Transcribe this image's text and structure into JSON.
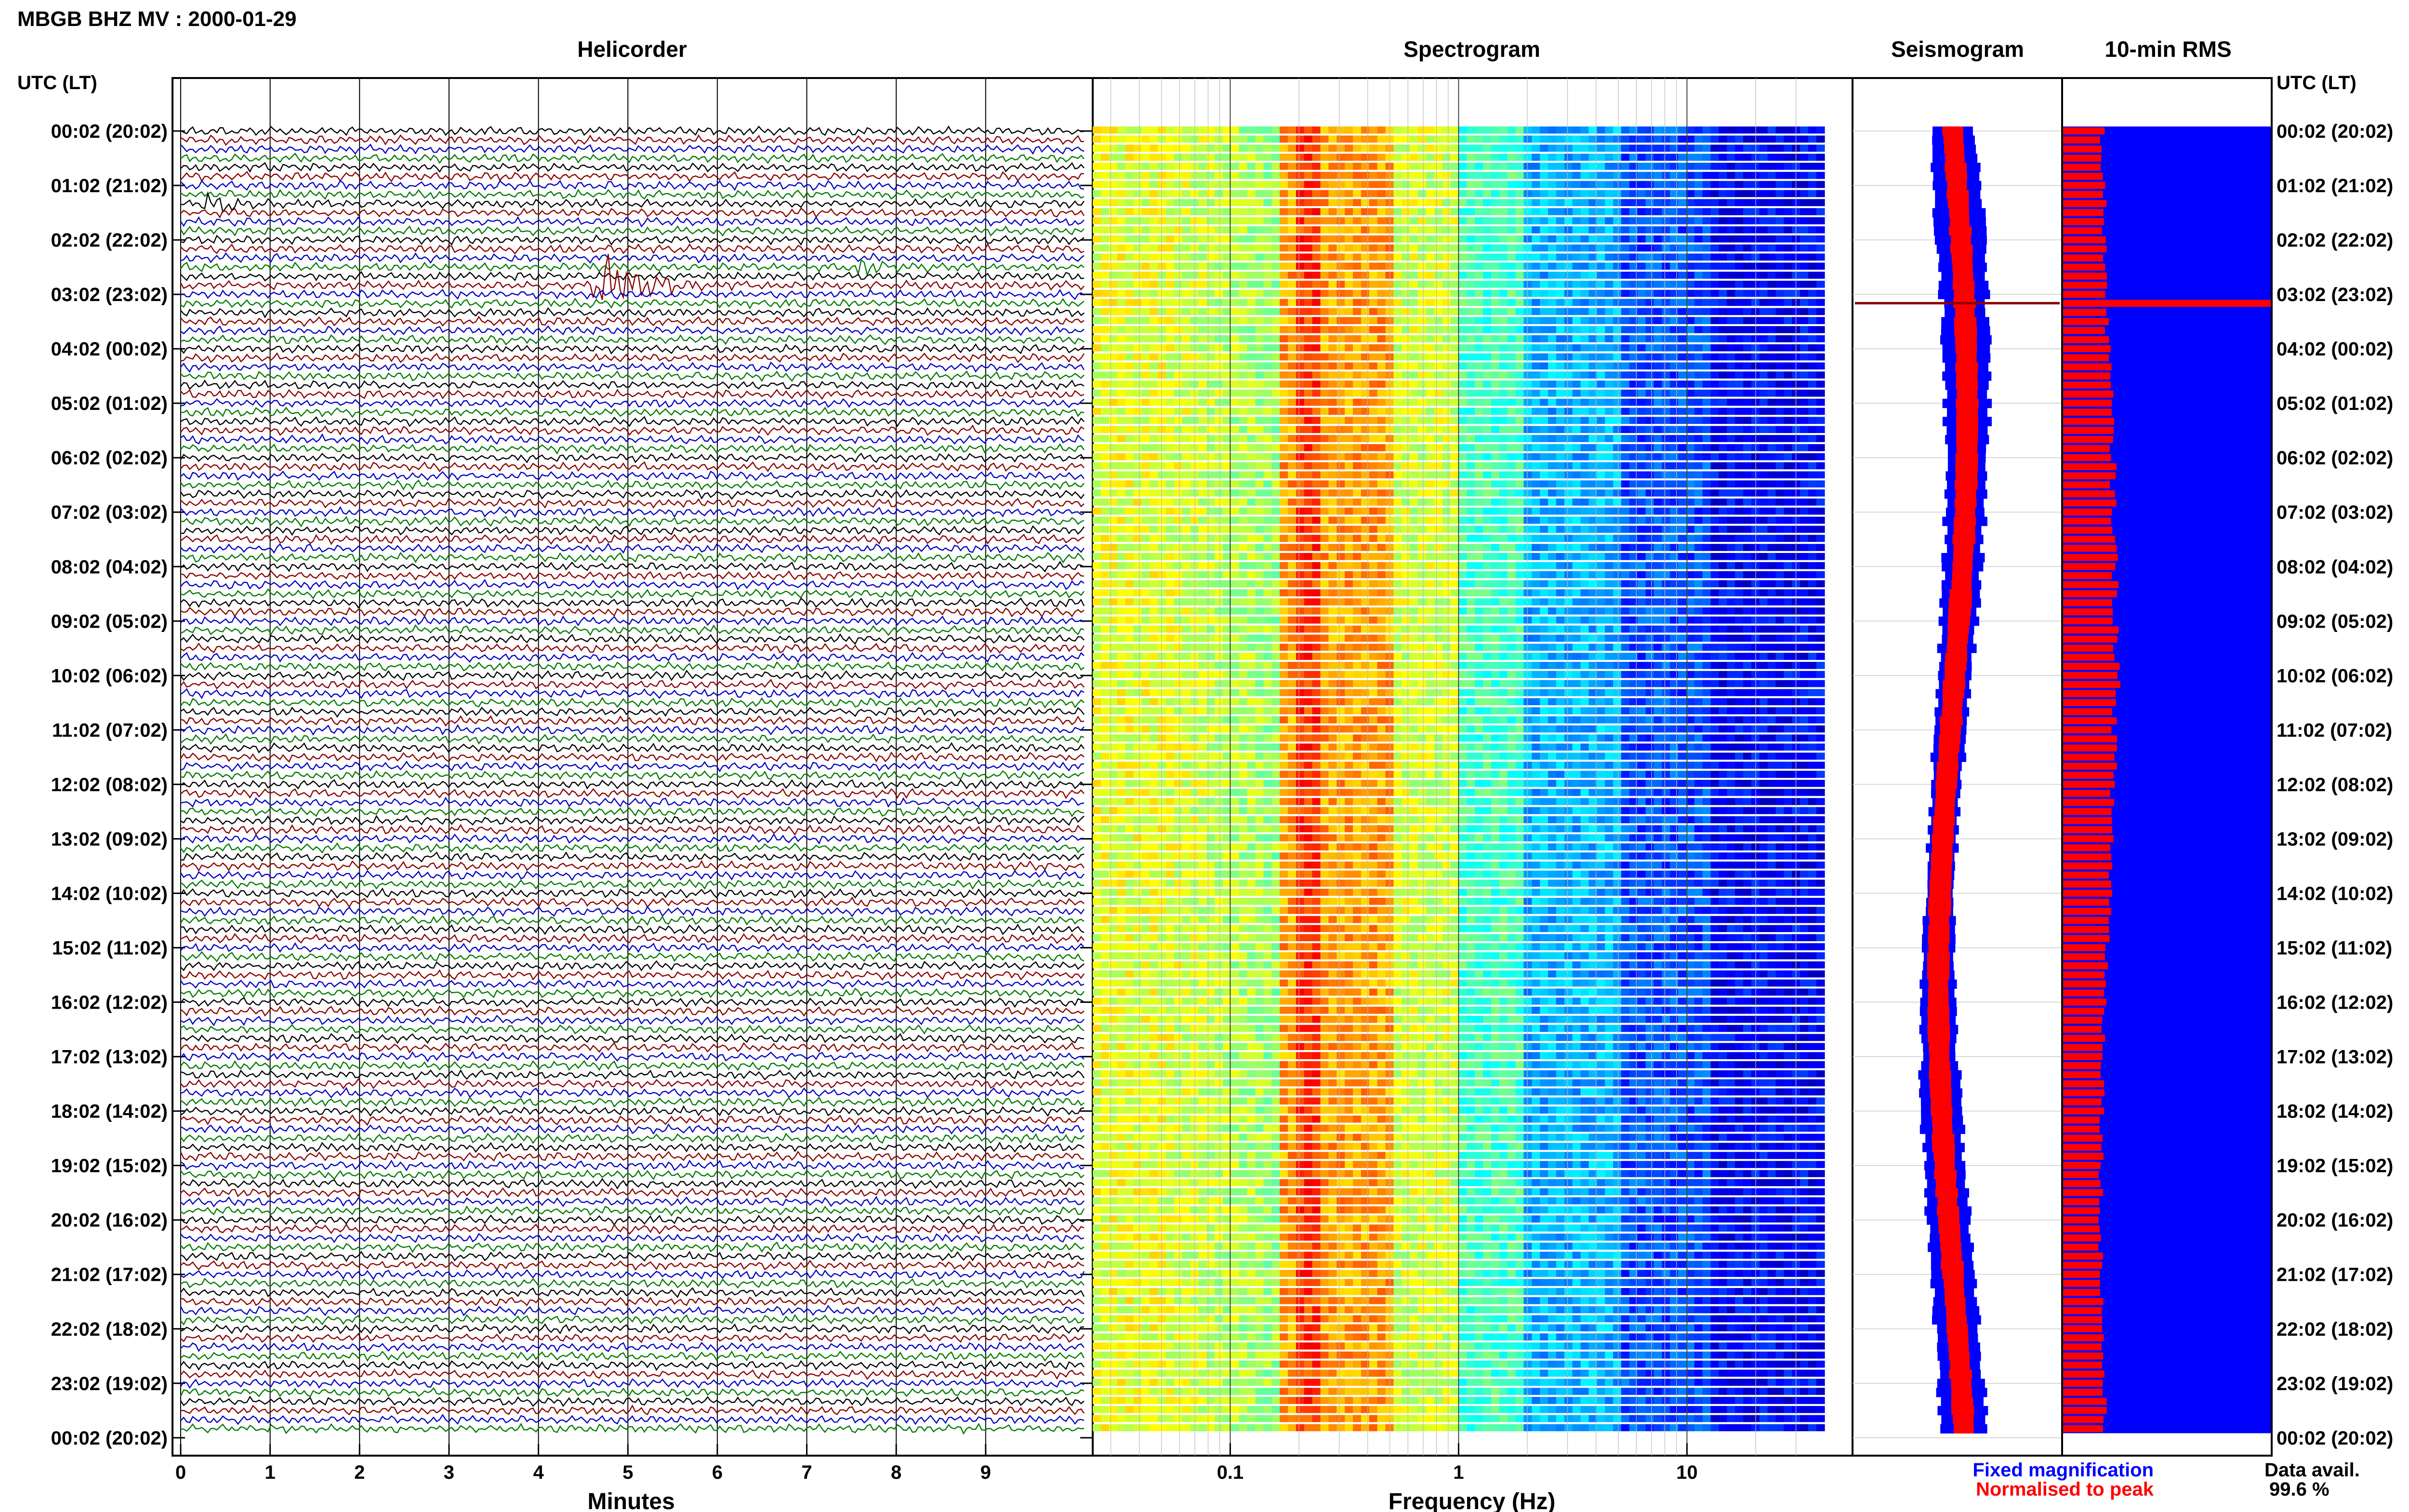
{
  "page_title": "MBGB BHZ MV : 2000-01-29",
  "utc_header_left": "UTC (LT)",
  "utc_header_right": "UTC (LT)",
  "panels": {
    "helicorder": {
      "title": "Helicorder",
      "xlabel": "Minutes",
      "xticks": [
        "0",
        "1",
        "2",
        "3",
        "4",
        "5",
        "6",
        "7",
        "8",
        "9"
      ],
      "trace_colors": [
        "#000000",
        "#8b0000",
        "#0000c8",
        "#007a00"
      ]
    },
    "spectrogram": {
      "title": "Spectrogram",
      "xlabel": "Frequency (Hz)",
      "xticks": [
        "0.1",
        "1",
        "10"
      ],
      "colormap": [
        "#00008f",
        "#0000ff",
        "#0080ff",
        "#00ffff",
        "#80ff80",
        "#ffff00",
        "#ff8000",
        "#ff0000",
        "#800000"
      ]
    },
    "seismogram": {
      "title": "Seismogram",
      "legend_fixed": "Fixed magnification",
      "legend_fixed_color": "#0000ff",
      "legend_norm": "Normalised to peak",
      "legend_norm_color": "#ff0000"
    },
    "rms": {
      "title": "10-min RMS",
      "bar_color": "#ff0000",
      "background_color": "#0000ff"
    }
  },
  "data_avail_label": "Data avail.",
  "data_avail_value": "99.6 %",
  "time_labels": [
    "00:02 (20:02)",
    "01:02 (21:02)",
    "02:02 (22:02)",
    "03:02 (23:02)",
    "04:02 (00:02)",
    "05:02 (01:02)",
    "06:02 (02:02)",
    "07:02 (03:02)",
    "08:02 (04:02)",
    "09:02 (05:02)",
    "10:02 (06:02)",
    "11:02 (07:02)",
    "12:02 (08:02)",
    "13:02 (09:02)",
    "14:02 (10:02)",
    "15:02 (11:02)",
    "16:02 (12:02)",
    "17:02 (13:02)",
    "18:02 (14:02)",
    "19:02 (15:02)",
    "20:02 (16:02)",
    "21:02 (17:02)",
    "22:02 (18:02)",
    "23:02 (19:02)",
    "00:02 (20:02)"
  ],
  "chart_data": {
    "type": "heatmap",
    "title": "MBGB BHZ MV : 2000-01-29",
    "rows_per_hour": 6,
    "row_count": 144,
    "rms_profile_rows": [
      0,
      12,
      24,
      36,
      48,
      60,
      72,
      84,
      96,
      108,
      120,
      132,
      143
    ],
    "rms_profile_values": [
      0.19,
      0.2,
      0.22,
      0.24,
      0.25,
      0.26,
      0.24,
      0.23,
      0.2,
      0.19,
      0.18,
      0.19,
      0.2
    ],
    "rms_spike_row": 19,
    "seismogram_width_profile": [
      0.38,
      0.42,
      0.4,
      0.36,
      0.33,
      0.3,
      0.26,
      0.24,
      0.3,
      0.34,
      0.36,
      0.38,
      0.4
    ],
    "events": [
      {
        "row": 17,
        "minute": 4.5,
        "duration_min": 1.7,
        "amplitude": "large"
      },
      {
        "row": 8,
        "minute": 0.2,
        "duration_min": 1.2,
        "amplitude": "medium"
      },
      {
        "row": 15,
        "minute": 7.4,
        "duration_min": 0.9,
        "amplitude": "medium"
      }
    ]
  }
}
